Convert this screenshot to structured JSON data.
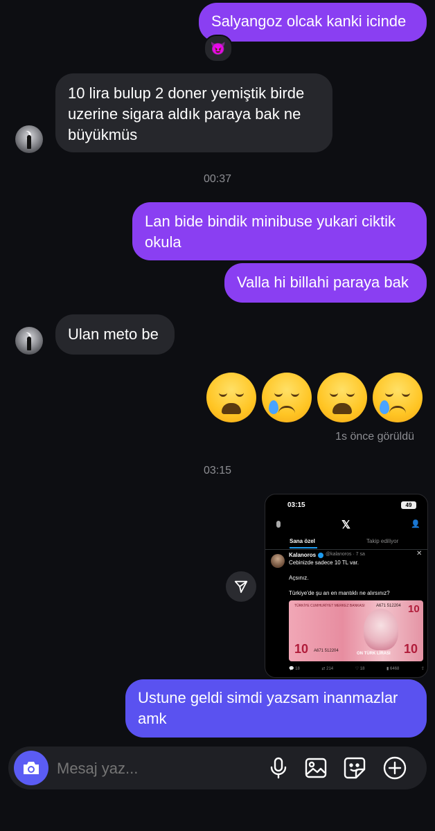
{
  "messages": {
    "m1": "Salyangoz olcak kanki icinde",
    "m1_reaction": "😈",
    "m2": "10 lira bulup 2 doner yemiştik birde uzerine sigara aldık paraya bak ne büyükmüs",
    "ts1": "00:37",
    "m3": "Lan bide bindik minibuse yukari ciktik okula",
    "m4": "Valla hi billahi paraya bak",
    "m5": "Ulan meto be",
    "seen": "1s önce görüldü",
    "ts2": "03:15",
    "m6": "Ustune geldi simdi yazsam inanmazlar amk"
  },
  "emojis": [
    "weary-face",
    "crying-face",
    "weary-face",
    "crying-face"
  ],
  "shared_post": {
    "status_time": "03:15",
    "battery": "49",
    "tab_for_you": "Sana özel",
    "tab_following": "Takip ediliyor",
    "author": "Kalanoros",
    "handle": "@kalanoros · 7 sa",
    "line1": "Cebinizde sadece 10 TL var.",
    "line2": "Açsınız.",
    "line3": "Türkiye'de şu an en mantıklı ne alırsınız?",
    "note_bank": "TÜRKİYE CUMHURİYET MERKEZ BANKASI",
    "note_serial": "A671 512204",
    "note_value": "10",
    "note_text": "ON TÜRK LİRASI",
    "replies": "18",
    "reposts": "214",
    "likes": "18",
    "views": "6468"
  },
  "composer": {
    "placeholder": "Mesaj yaz..."
  },
  "colors": {
    "background": "#0d0e12",
    "outgoing": "#8a3ff2",
    "outgoing_last": "#5a52f0",
    "incoming": "#26272c",
    "camera": "#5b5cf4"
  }
}
